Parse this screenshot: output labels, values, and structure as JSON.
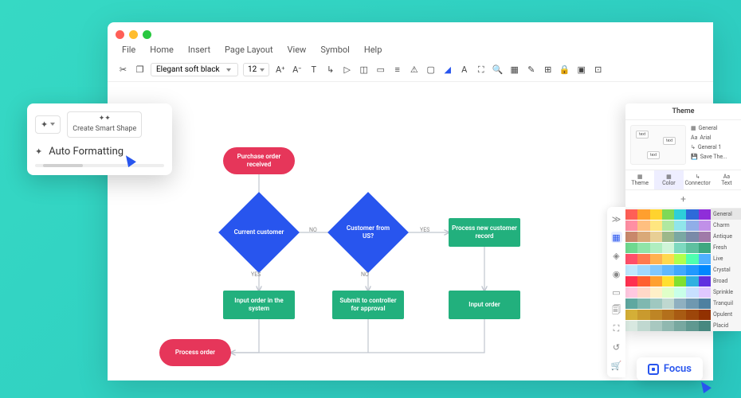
{
  "menu": {
    "file": "File",
    "home": "Home",
    "insert": "Insert",
    "page": "Page Layout",
    "view": "View",
    "symbol": "Symbol",
    "help": "Help"
  },
  "toolbar": {
    "font": "Elegant soft black",
    "size": "12"
  },
  "flow": {
    "start": "Purchase order received",
    "d1": "Current customer",
    "d2": "Customer from US?",
    "p1": "Process new customer record",
    "p2": "Input order in the system",
    "p3": "Submit to controller for approval",
    "p4": "Input order",
    "end": "Process order",
    "yes": "YES",
    "no": "NO"
  },
  "popup": {
    "smart": "Create Smart Shape",
    "auto": "Auto Formatting"
  },
  "theme": {
    "title": "Theme",
    "opts": [
      "General",
      "Arial",
      "General 1",
      "Save The..."
    ],
    "tabs": [
      "Theme",
      "Color",
      "Connector",
      "Text"
    ],
    "palettes": [
      "General",
      "Charm",
      "Antique",
      "Fresh",
      "Live",
      "Crystal",
      "Broad",
      "Sprinkle",
      "Tranquil",
      "Opulent",
      "Placid"
    ],
    "preview_text": "text"
  },
  "focus": "Focus",
  "palette_colors": [
    [
      "#ff5f57",
      "#ff9f2e",
      "#ffd32e",
      "#7ed957",
      "#2ecfd9",
      "#2e6ad9",
      "#8f2ed9"
    ],
    [
      "#ff8fa3",
      "#ffbf80",
      "#ffe680",
      "#b0e8a0",
      "#90e5ea",
      "#90aee8",
      "#c090e8"
    ],
    [
      "#c9886b",
      "#d9a978",
      "#e8cf95",
      "#9db88a",
      "#7aa8a3",
      "#7a8aa8",
      "#a07aa8"
    ],
    [
      "#6fd98f",
      "#8fe5a8",
      "#b0eec0",
      "#d0f5d8",
      "#7ed9c0",
      "#5ec0a0",
      "#3ea880"
    ],
    [
      "#ff4f6a",
      "#ff7a4f",
      "#ffb14f",
      "#ffd94f",
      "#b0ff4f",
      "#4fffb0",
      "#4fb0ff"
    ],
    [
      "#bfe8ff",
      "#a0d8ff",
      "#80c8ff",
      "#60b8ff",
      "#40a8ff",
      "#2098ff",
      "#0088ff"
    ],
    [
      "#ff3050",
      "#ff6030",
      "#ffa030",
      "#ffe030",
      "#80e030",
      "#30b0e0",
      "#6030e0"
    ],
    [
      "#ffc8e0",
      "#ffd8c8",
      "#fff0c8",
      "#e0ffc8",
      "#c8ffe8",
      "#c8e0ff",
      "#e0c8ff"
    ],
    [
      "#5fa8a0",
      "#7fb8b0",
      "#9fc8c0",
      "#bfd8d0",
      "#8fb0c0",
      "#6f98b0",
      "#4f80a0"
    ],
    [
      "#d4af37",
      "#c99a2e",
      "#be8525",
      "#b3701c",
      "#a85b13",
      "#9d460a",
      "#923101"
    ],
    [
      "#d8e8e0",
      "#c0d8d0",
      "#a8c8c0",
      "#90b8b0",
      "#78a8a0",
      "#609890",
      "#488880"
    ]
  ]
}
